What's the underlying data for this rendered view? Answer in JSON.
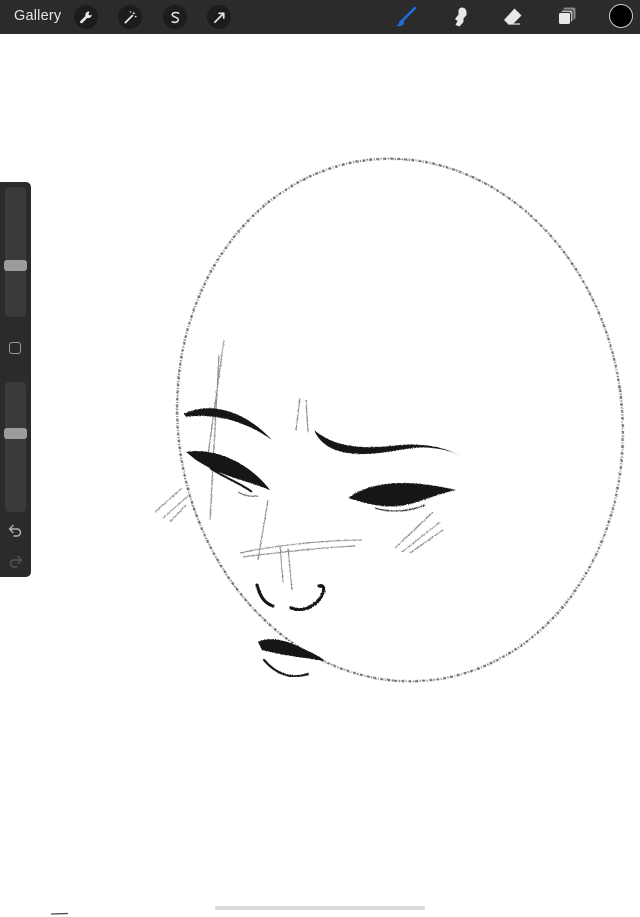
{
  "toolbar": {
    "gallery_label": "Gallery",
    "left_tools": [
      "wrench-icon",
      "magic-wand-icon",
      "selection-icon",
      "transform-icon"
    ],
    "right_tools": [
      "brush-icon",
      "smudge-icon",
      "eraser-icon",
      "layers-icon"
    ],
    "active_tool": "brush-icon",
    "active_color": "#1d6fe0",
    "current_color": "#000000"
  },
  "sidebar": {
    "brush_size_level": 0.38,
    "opacity_level": 0.62
  },
  "canvas": {
    "background": "#ffffff",
    "ink_color": "#111111"
  }
}
